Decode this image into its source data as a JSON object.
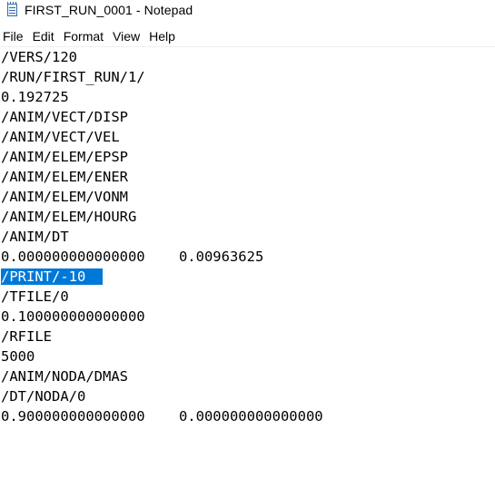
{
  "window": {
    "title": "FIRST_RUN_0001 - Notepad",
    "app_icon": "notepad-icon"
  },
  "menu": {
    "items": [
      "File",
      "Edit",
      "Format",
      "View",
      "Help"
    ]
  },
  "editor": {
    "lines": [
      "/VERS/120",
      "/RUN/FIRST_RUN/1/",
      "0.192725",
      "/ANIM/VECT/DISP",
      "/ANIM/VECT/VEL",
      "/ANIM/ELEM/EPSP",
      "/ANIM/ELEM/ENER",
      "/ANIM/ELEM/VONM",
      "/ANIM/ELEM/HOURG",
      "/ANIM/DT",
      "0.000000000000000    0.00963625",
      "/PRINT/-10",
      "/TFILE/0",
      "0.100000000000000",
      "/RFILE",
      "5000",
      "/ANIM/NODA/DMAS",
      "/DT/NODA/0",
      "0.900000000000000    0.000000000000000"
    ],
    "selected_text": "/PRINT/-10",
    "selection_color": "#0078d7"
  }
}
